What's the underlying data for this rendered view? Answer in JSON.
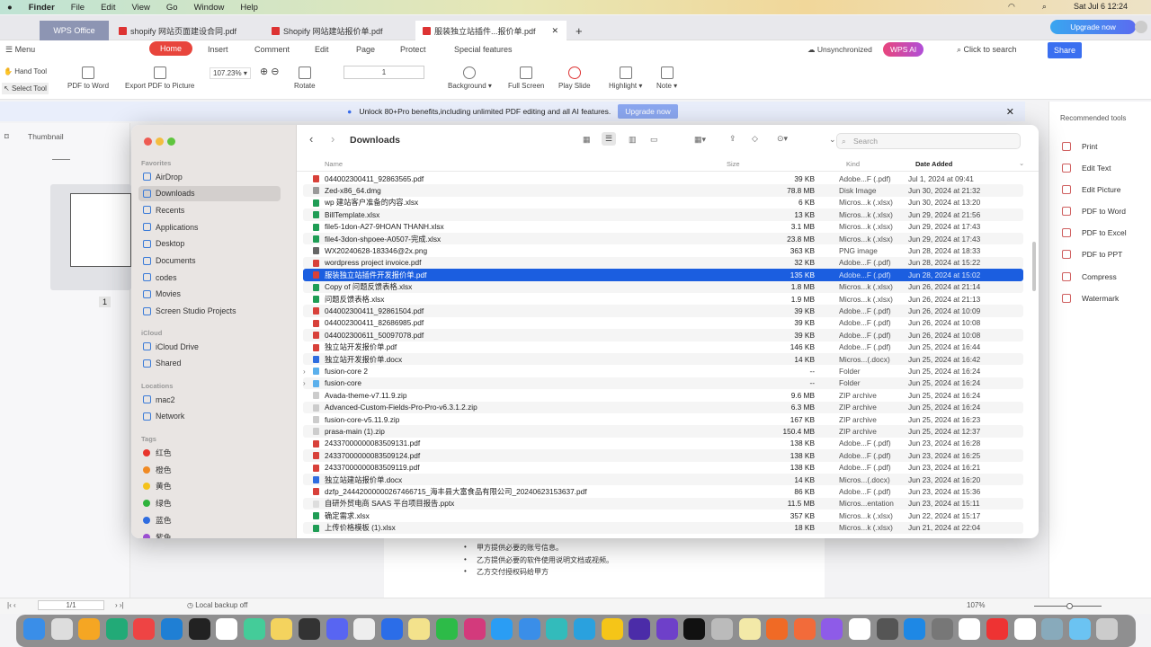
{
  "menubar": {
    "items": [
      "Finder",
      "File",
      "Edit",
      "View",
      "Go",
      "Window",
      "Help"
    ],
    "clock": "Sat Jul 6  12:24"
  },
  "tabs": [
    {
      "label": "WPS Office"
    },
    {
      "label": "shopify 网站页面建设合同.pdf"
    },
    {
      "label": "Shopify 网站建站报价单.pdf"
    },
    {
      "label": "服装独立站插件...报价单.pdf"
    }
  ],
  "top_right": {
    "upgrade": "Upgrade now"
  },
  "ribbon": {
    "menu": "Menu",
    "tabs": [
      "Home",
      "Insert",
      "Comment",
      "Edit",
      "Page",
      "Protect",
      "Special features"
    ],
    "unsync": "Unsynchronized",
    "wps_ai": "WPS AI",
    "search": "Click to search",
    "share": "Share",
    "hand_tool": "Hand Tool",
    "select_tool": "Select Tool",
    "pdf_to_word": "PDF to Word",
    "export_picture": "Export PDF to Picture",
    "zoom": "107.23%",
    "rotate": "Rotate",
    "page": "1",
    "background": "Background",
    "full_screen": "Full Screen",
    "play_slide": "Play Slide",
    "highlight": "Highlight",
    "note": "Note"
  },
  "banner": {
    "text": "Unlock 80+Pro benefits,including unlimited PDF editing and all AI features.",
    "button": "Upgrade now"
  },
  "left_panel": {
    "title": "Thumbnail",
    "page_num": "1"
  },
  "right_panel": {
    "title": "Recommended tools",
    "tools": [
      "Print",
      "Edit Text",
      "Edit Picture",
      "PDF to Word",
      "PDF to Excel",
      "PDF to PPT",
      "Compress",
      "Watermark"
    ]
  },
  "document": {
    "lines": [
      "甲方提供必要的账号信息。",
      "乙方提供必要的软件使用说明文档或视频。",
      "乙方交付授权码给甲方"
    ]
  },
  "statusbar": {
    "page": "1/1",
    "backup": "Local backup off",
    "zoom": "107%"
  },
  "finder": {
    "title": "Downloads",
    "search_placeholder": "Search",
    "sidebar": {
      "favorites_label": "Favorites",
      "favorites": [
        "AirDrop",
        "Downloads",
        "Recents",
        "Applications",
        "Desktop",
        "Documents",
        "codes",
        "Movies",
        "Screen Studio Projects"
      ],
      "icloud_label": "iCloud",
      "icloud": [
        "iCloud Drive",
        "Shared"
      ],
      "locations_label": "Locations",
      "locations": [
        "mac2",
        "Network"
      ],
      "tags_label": "Tags",
      "tags": [
        {
          "name": "红色",
          "color": "#e8352c"
        },
        {
          "name": "橙色",
          "color": "#f08a24"
        },
        {
          "name": "黄色",
          "color": "#f4c21b"
        },
        {
          "name": "绿色",
          "color": "#2fb33c"
        },
        {
          "name": "蓝色",
          "color": "#2f6de0"
        },
        {
          "name": "紫色",
          "color": "#9b4fd1"
        }
      ]
    },
    "columns": {
      "name": "Name",
      "size": "Size",
      "kind": "Kind",
      "date": "Date Added"
    },
    "files": [
      {
        "name": "044002300411_92863565.pdf",
        "size": "39 KB",
        "kind": "Adobe...F (.pdf)",
        "date": "Jul 1, 2024 at 09:41",
        "type": "pdf"
      },
      {
        "name": "Zed-x86_64.dmg",
        "size": "78.8 MB",
        "kind": "Disk Image",
        "date": "Jun 30, 2024 at 21:32",
        "type": "dmg"
      },
      {
        "name": "wp 建站客户准备的内容.xlsx",
        "size": "6 KB",
        "kind": "Micros...k (.xlsx)",
        "date": "Jun 30, 2024 at 13:20",
        "type": "xlsx"
      },
      {
        "name": "BillTemplate.xlsx",
        "size": "13 KB",
        "kind": "Micros...k (.xlsx)",
        "date": "Jun 29, 2024 at 21:56",
        "type": "xlsx"
      },
      {
        "name": "file5-1don-A27-9HOAN THANH.xlsx",
        "size": "3.1 MB",
        "kind": "Micros...k (.xlsx)",
        "date": "Jun 29, 2024 at 17:43",
        "type": "xlsx"
      },
      {
        "name": "file4-3don-shpoee-A0507-完成.xlsx",
        "size": "23.8 MB",
        "kind": "Micros...k (.xlsx)",
        "date": "Jun 29, 2024 at 17:43",
        "type": "xlsx"
      },
      {
        "name": "WX20240628-183346@2x.png",
        "size": "363 KB",
        "kind": "PNG image",
        "date": "Jun 28, 2024 at 18:33",
        "type": "png"
      },
      {
        "name": "wordpress project invoice.pdf",
        "size": "32 KB",
        "kind": "Adobe...F (.pdf)",
        "date": "Jun 28, 2024 at 15:22",
        "type": "pdf"
      },
      {
        "name": "服装独立站插件开发报价单.pdf",
        "size": "135 KB",
        "kind": "Adobe...F (.pdf)",
        "date": "Jun 28, 2024 at 15:02",
        "type": "pdf",
        "selected": true
      },
      {
        "name": "Copy of 问题反馈表格.xlsx",
        "size": "1.8 MB",
        "kind": "Micros...k (.xlsx)",
        "date": "Jun 26, 2024 at 21:14",
        "type": "xlsx"
      },
      {
        "name": "问题反馈表格.xlsx",
        "size": "1.9 MB",
        "kind": "Micros...k (.xlsx)",
        "date": "Jun 26, 2024 at 21:13",
        "type": "xlsx"
      },
      {
        "name": "044002300411_92861504.pdf",
        "size": "39 KB",
        "kind": "Adobe...F (.pdf)",
        "date": "Jun 26, 2024 at 10:09",
        "type": "pdf"
      },
      {
        "name": "044002300411_82686985.pdf",
        "size": "39 KB",
        "kind": "Adobe...F (.pdf)",
        "date": "Jun 26, 2024 at 10:08",
        "type": "pdf"
      },
      {
        "name": "044002300611_50097078.pdf",
        "size": "39 KB",
        "kind": "Adobe...F (.pdf)",
        "date": "Jun 26, 2024 at 10:08",
        "type": "pdf"
      },
      {
        "name": "独立站开发报价单.pdf",
        "size": "146 KB",
        "kind": "Adobe...F (.pdf)",
        "date": "Jun 25, 2024 at 16:44",
        "type": "pdf"
      },
      {
        "name": "独立站开发报价单.docx",
        "size": "14 KB",
        "kind": "Micros...(.docx)",
        "date": "Jun 25, 2024 at 16:42",
        "type": "docx"
      },
      {
        "name": "fusion-core 2",
        "size": "--",
        "kind": "Folder",
        "date": "Jun 25, 2024 at 16:24",
        "type": "folder"
      },
      {
        "name": "fusion-core",
        "size": "--",
        "kind": "Folder",
        "date": "Jun 25, 2024 at 16:24",
        "type": "folder"
      },
      {
        "name": "Avada-theme-v7.11.9.zip",
        "size": "9.6 MB",
        "kind": "ZIP archive",
        "date": "Jun 25, 2024 at 16:24",
        "type": "zip"
      },
      {
        "name": "Advanced-Custom-Fields-Pro-Pro-v6.3.1.2.zip",
        "size": "6.3 MB",
        "kind": "ZIP archive",
        "date": "Jun 25, 2024 at 16:24",
        "type": "zip"
      },
      {
        "name": "fusion-core-v5.11.9.zip",
        "size": "167 KB",
        "kind": "ZIP archive",
        "date": "Jun 25, 2024 at 16:23",
        "type": "zip"
      },
      {
        "name": "prasa-main (1).zip",
        "size": "150.4 MB",
        "kind": "ZIP archive",
        "date": "Jun 25, 2024 at 12:37",
        "type": "zip"
      },
      {
        "name": "24337000000083509131.pdf",
        "size": "138 KB",
        "kind": "Adobe...F (.pdf)",
        "date": "Jun 23, 2024 at 16:28",
        "type": "pdf"
      },
      {
        "name": "24337000000083509124.pdf",
        "size": "138 KB",
        "kind": "Adobe...F (.pdf)",
        "date": "Jun 23, 2024 at 16:25",
        "type": "pdf"
      },
      {
        "name": "24337000000083509119.pdf",
        "size": "138 KB",
        "kind": "Adobe...F (.pdf)",
        "date": "Jun 23, 2024 at 16:21",
        "type": "pdf"
      },
      {
        "name": "独立站建站报价单.docx",
        "size": "14 KB",
        "kind": "Micros...(.docx)",
        "date": "Jun 23, 2024 at 16:20",
        "type": "docx"
      },
      {
        "name": "dzfp_24442000000267466715_海丰县大富食品有限公司_20240623153637.pdf",
        "size": "86 KB",
        "kind": "Adobe...F (.pdf)",
        "date": "Jun 23, 2024 at 15:36",
        "type": "pdf"
      },
      {
        "name": "自研外贸电商 SAAS 平台项目报告.pptx",
        "size": "11.5 MB",
        "kind": "Micros...entation",
        "date": "Jun 23, 2024 at 15:11",
        "type": "pptx"
      },
      {
        "name": "确定需求.xlsx",
        "size": "357 KB",
        "kind": "Micros...k (.xlsx)",
        "date": "Jun 22, 2024 at 15:17",
        "type": "xlsx"
      },
      {
        "name": "上传价格模板 (1).xlsx",
        "size": "18 KB",
        "kind": "Micros...k (.xlsx)",
        "date": "Jun 21, 2024 at 22:04",
        "type": "xlsx"
      }
    ]
  },
  "dock": [
    "finder",
    "launchpad",
    "photos",
    "chatgpt",
    "chrome",
    "vscode",
    "terminal",
    "reminders",
    "chatgpt-alt",
    "notes",
    "obs",
    "discord",
    "textedit",
    "lark",
    "stickies",
    "wechat",
    "wps",
    "qq",
    "mail",
    "boss",
    "telegram",
    "whatsapp",
    "arc",
    "github",
    "capcut",
    "system-settings",
    "cursor",
    "postman",
    "pencil",
    "downloader",
    "freeform",
    "imageoptim",
    "app-store",
    "settings",
    "calendar",
    "wps-pdf",
    "mongodb",
    "preview",
    "downloads-folder",
    "trash"
  ],
  "colors": {
    "accent": "#1b5ee0",
    "wps_red": "#e8453c",
    "share_blue": "#3a6ff0"
  }
}
